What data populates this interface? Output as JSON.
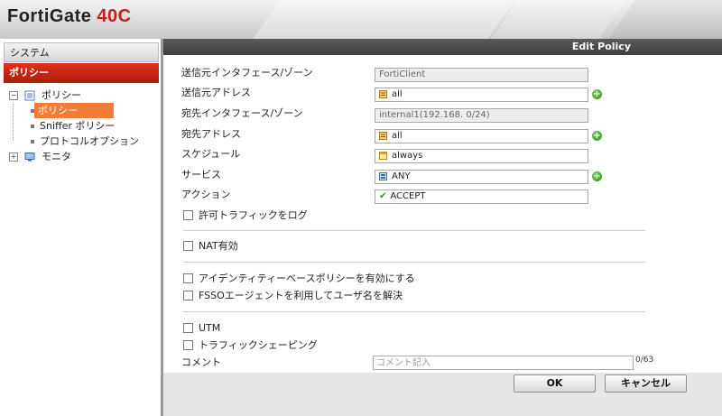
{
  "header": {
    "brand": "FortiGate",
    "model": "40C"
  },
  "sidebar": {
    "system_label": "システム",
    "policy_label": "ポリシー",
    "tree": {
      "root_policy": "ポリシー",
      "children": [
        "ポリシー",
        "Sniffer ポリシー",
        "プロトコルオプション"
      ],
      "monitor": "モニタ"
    }
  },
  "dialog": {
    "title": "Edit Policy",
    "fields": {
      "src_interface_label": "送信元インタフェース/ゾーン",
      "src_interface_value": "FortiClient",
      "src_address_label": "送信元アドレス",
      "src_address_value": "all",
      "dst_interface_label": "宛先インタフェース/ゾーン",
      "dst_interface_value": "internal1(192.168.      0/24)",
      "dst_address_label": "宛先アドレス",
      "dst_address_value": "all",
      "schedule_label": "スケジュール",
      "schedule_value": "always",
      "service_label": "サービス",
      "service_value": "ANY",
      "action_label": "アクション",
      "action_value": "ACCEPT"
    },
    "checkboxes": {
      "log_allowed": "許可トラフィックをログ",
      "nat": "NAT有効",
      "identity_policy": "アイデンティティーベースポリシーを有効にする",
      "fsso": "FSSOエージェントを利用してユーザ名を解決",
      "utm": "UTM",
      "traffic_shaping": "トラフィックシェーピング"
    },
    "comment": {
      "label": "コメント",
      "placeholder": "コメント記入",
      "counter": "0/63"
    },
    "buttons": {
      "ok": "OK",
      "cancel": "キャンセル"
    }
  },
  "colors": {
    "accent_red": "#c0201c",
    "selected_orange": "#f07d39",
    "title_bar": "#4a4a4a"
  }
}
